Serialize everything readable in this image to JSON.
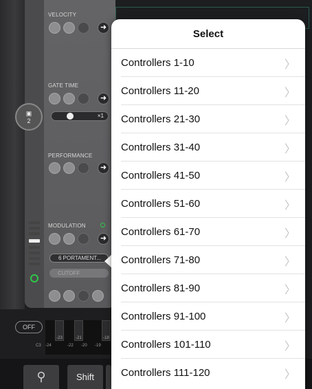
{
  "left_panel": {
    "velocity_label": "VELOCITY",
    "gate_time_label": "GATE TIME",
    "gate_multiplier": "×1",
    "performance_label": "PERFORMANCE",
    "modulation_label": "MODULATION",
    "save_slot": "2",
    "mod_target": "6 PORTAMENT...",
    "mod_param": "CUTOFF",
    "off_label": "OFF",
    "key_numbers": [
      "-23",
      "-21",
      "-18"
    ],
    "key_bottom_labels": [
      "C3",
      "-24",
      "-22",
      "-20",
      "-19"
    ]
  },
  "toolbar": {
    "shift_label": "Shift"
  },
  "popover": {
    "title": "Select",
    "items": [
      "Controllers 1-10",
      "Controllers 11-20",
      "Controllers 21-30",
      "Controllers 31-40",
      "Controllers 41-50",
      "Controllers 51-60",
      "Controllers 61-70",
      "Controllers 71-80",
      "Controllers 81-90",
      "Controllers 91-100",
      "Controllers 101-110",
      "Controllers 111-120"
    ]
  },
  "colors": {
    "accent_green": "#2ec84a",
    "popover_bg": "#ffffff",
    "panel_gray": "#5e5e60"
  },
  "icons": [
    "save-icon",
    "arrow-right-icon",
    "power-icon",
    "search-icon",
    "chevron-right-icon"
  ]
}
